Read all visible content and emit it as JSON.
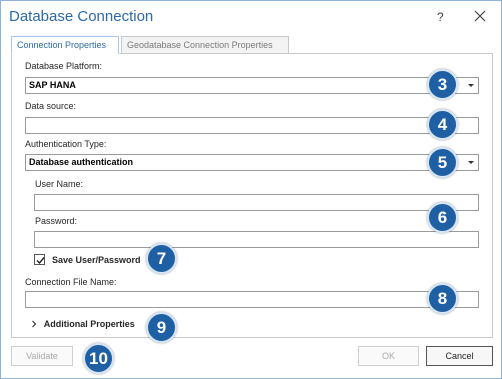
{
  "window": {
    "title": "Database Connection",
    "help_label": "?",
    "close_icon": "close-icon"
  },
  "tabs": [
    {
      "label": "Connection Properties",
      "active": true
    },
    {
      "label": "Geodatabase Connection Properties",
      "active": false
    }
  ],
  "form": {
    "platform": {
      "label": "Database Platform:",
      "value": "SAP HANA"
    },
    "data_source": {
      "label": "Data source:",
      "value": ""
    },
    "auth_type": {
      "label": "Authentication Type:",
      "value": "Database authentication"
    },
    "user_name": {
      "label": "User Name:",
      "value": ""
    },
    "password": {
      "label": "Password:",
      "value": ""
    },
    "save_user": {
      "label": "Save User/Password",
      "checked": true
    },
    "connection_file": {
      "label": "Connection File Name:",
      "value": ""
    },
    "additional": {
      "label": "Additional Properties",
      "expander_icon": "chevron-right-icon"
    }
  },
  "buttons": {
    "validate": "Validate",
    "ok": "OK",
    "cancel": "Cancel"
  },
  "callouts": [
    "3",
    "4",
    "5",
    "6",
    "7",
    "8",
    "9",
    "10"
  ],
  "colors": {
    "accent": "#2b6aa8",
    "callout": "#1f5fa3"
  }
}
